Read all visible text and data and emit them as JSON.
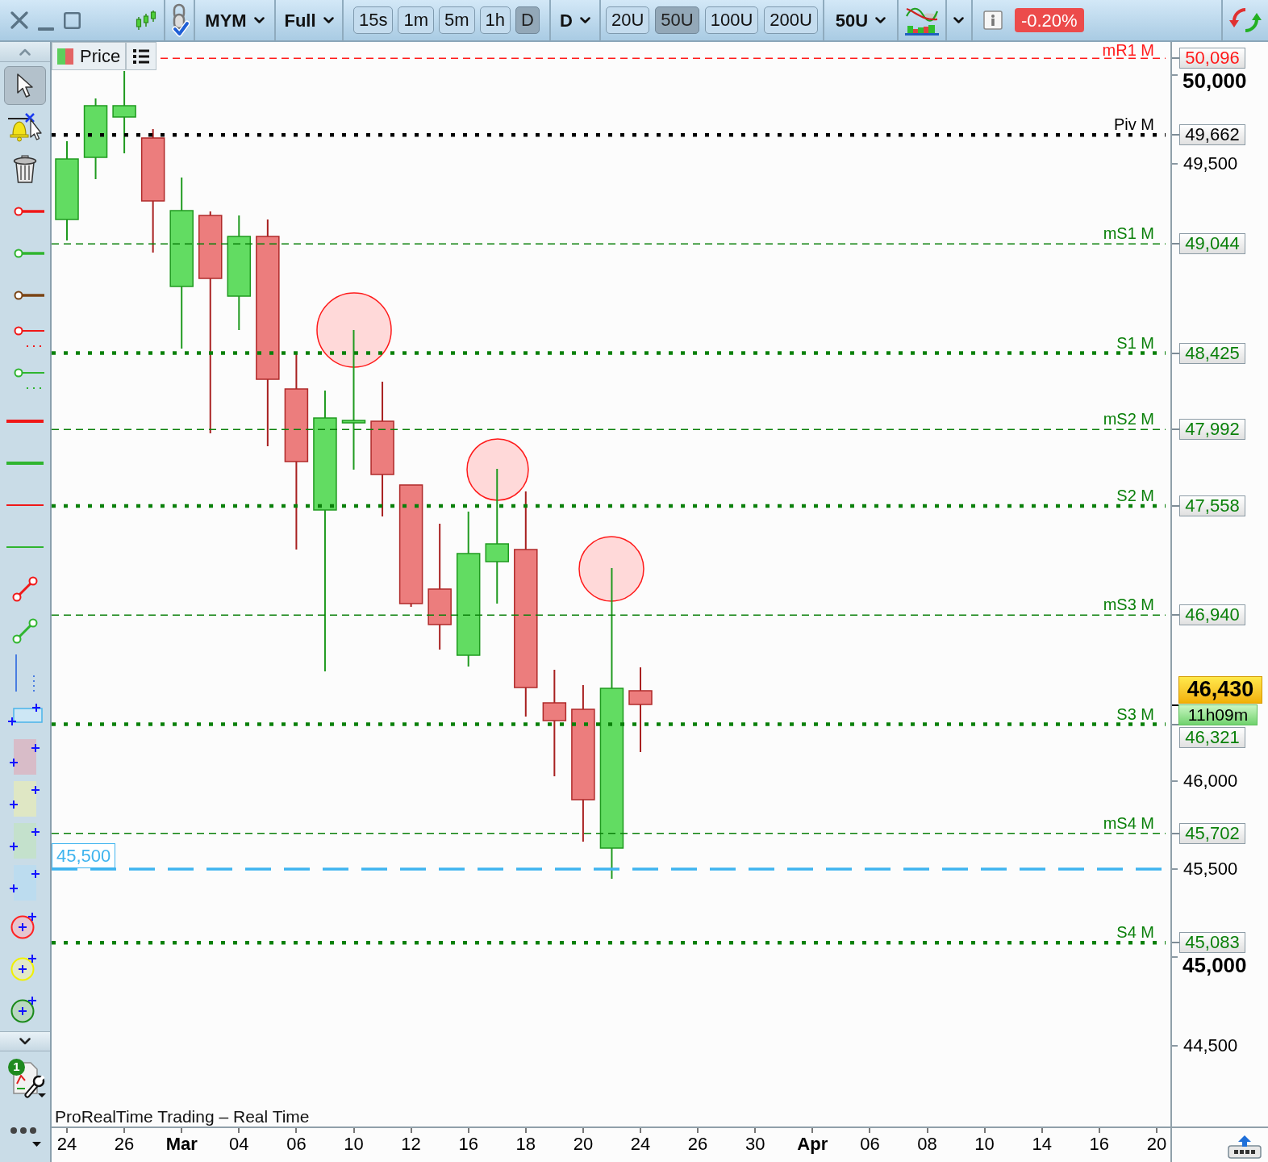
{
  "toolbar": {
    "instrument": "MYM",
    "view": "Full",
    "timeframes": [
      {
        "label": "15s",
        "selected": false
      },
      {
        "label": "1m",
        "selected": false
      },
      {
        "label": "5m",
        "selected": false
      },
      {
        "label": "1h",
        "selected": false
      },
      {
        "label": "D",
        "selected": true
      }
    ],
    "period": "D",
    "units": [
      {
        "label": "20U",
        "selected": false
      },
      {
        "label": "50U",
        "selected": true
      },
      {
        "label": "100U",
        "selected": false
      },
      {
        "label": "200U",
        "selected": false
      }
    ],
    "unit_menu": "50U",
    "change": "-0.20%"
  },
  "tools": [
    {
      "selected": true
    },
    {
      "selected": false
    },
    {
      "selected": false
    },
    {
      "selected": false
    },
    {
      "selected": false
    },
    {
      "selected": false
    },
    {
      "selected": false
    },
    {
      "selected": false
    },
    {
      "selected": false
    },
    {
      "selected": false
    },
    {
      "selected": false
    },
    {
      "selected": false
    },
    {
      "selected": false
    },
    {
      "selected": false
    },
    {
      "selected": false
    },
    {
      "selected": false
    },
    {
      "selected": false
    },
    {
      "selected": false
    },
    {
      "selected": false
    },
    {
      "selected": false
    },
    {
      "selected": false
    },
    {
      "selected": false
    },
    {
      "selected": false
    }
  ],
  "indicator_badge": "1",
  "legend": {
    "label": "Price"
  },
  "levels": [
    {
      "label": "mR1 M",
      "tag": "50,096",
      "kind": "dashed",
      "color": "#ff1a1a"
    },
    {
      "label": "Piv M",
      "tag": "49,662",
      "kind": "dotted",
      "color": "#000000"
    },
    {
      "label": "mS1 M",
      "tag": "49,044",
      "kind": "dashed",
      "color": "#0a800a"
    },
    {
      "label": "S1 M",
      "tag": "48,425",
      "kind": "dotted",
      "color": "#0a800a"
    },
    {
      "label": "mS2 M",
      "tag": "47,992",
      "kind": "dashed",
      "color": "#0a800a"
    },
    {
      "label": "S2 M",
      "tag": "47,558",
      "kind": "dotted",
      "color": "#0a800a"
    },
    {
      "label": "mS3 M",
      "tag": "46,940",
      "kind": "dashed",
      "color": "#0a800a"
    },
    {
      "label": "S3 M",
      "tag": "46,321",
      "kind": "dotted",
      "color": "#0a800a"
    },
    {
      "label": "mS4 M",
      "tag": "45,702",
      "kind": "dashed",
      "color": "#0a800a"
    },
    {
      "label": "S4 M",
      "tag": "45,083",
      "kind": "dotted",
      "color": "#0a800a"
    }
  ],
  "drawn_line": {
    "label": "45,500"
  },
  "last_price": {
    "price": "46,430",
    "timer": "11h09m"
  },
  "y_axis": {
    "ticks": [
      {
        "label": "50,000",
        "kind": "major"
      },
      {
        "label": "49,500",
        "kind": "minor"
      },
      {
        "label": "46,000",
        "kind": "minor"
      },
      {
        "label": "45,500",
        "kind": "minor"
      },
      {
        "label": "45,000",
        "kind": "major"
      },
      {
        "label": "44,500",
        "kind": "minor"
      }
    ]
  },
  "x_axis": {
    "ticks": [
      {
        "label": "24",
        "kind": "day"
      },
      {
        "label": "26",
        "kind": "day"
      },
      {
        "label": "Mar",
        "kind": "month"
      },
      {
        "label": "04",
        "kind": "day"
      },
      {
        "label": "06",
        "kind": "day"
      },
      {
        "label": "10",
        "kind": "day"
      },
      {
        "label": "12",
        "kind": "day"
      },
      {
        "label": "16",
        "kind": "day"
      },
      {
        "label": "18",
        "kind": "day"
      },
      {
        "label": "20",
        "kind": "day"
      },
      {
        "label": "24",
        "kind": "day"
      },
      {
        "label": "26",
        "kind": "day"
      },
      {
        "label": "30",
        "kind": "day"
      },
      {
        "label": "Apr",
        "kind": "month"
      },
      {
        "label": "06",
        "kind": "day"
      },
      {
        "label": "08",
        "kind": "day"
      },
      {
        "label": "10",
        "kind": "day"
      },
      {
        "label": "14",
        "kind": "day"
      },
      {
        "label": "16",
        "kind": "day"
      },
      {
        "label": "20",
        "kind": "day"
      }
    ]
  },
  "footer": "ProRealTime Trading – Real Time"
}
